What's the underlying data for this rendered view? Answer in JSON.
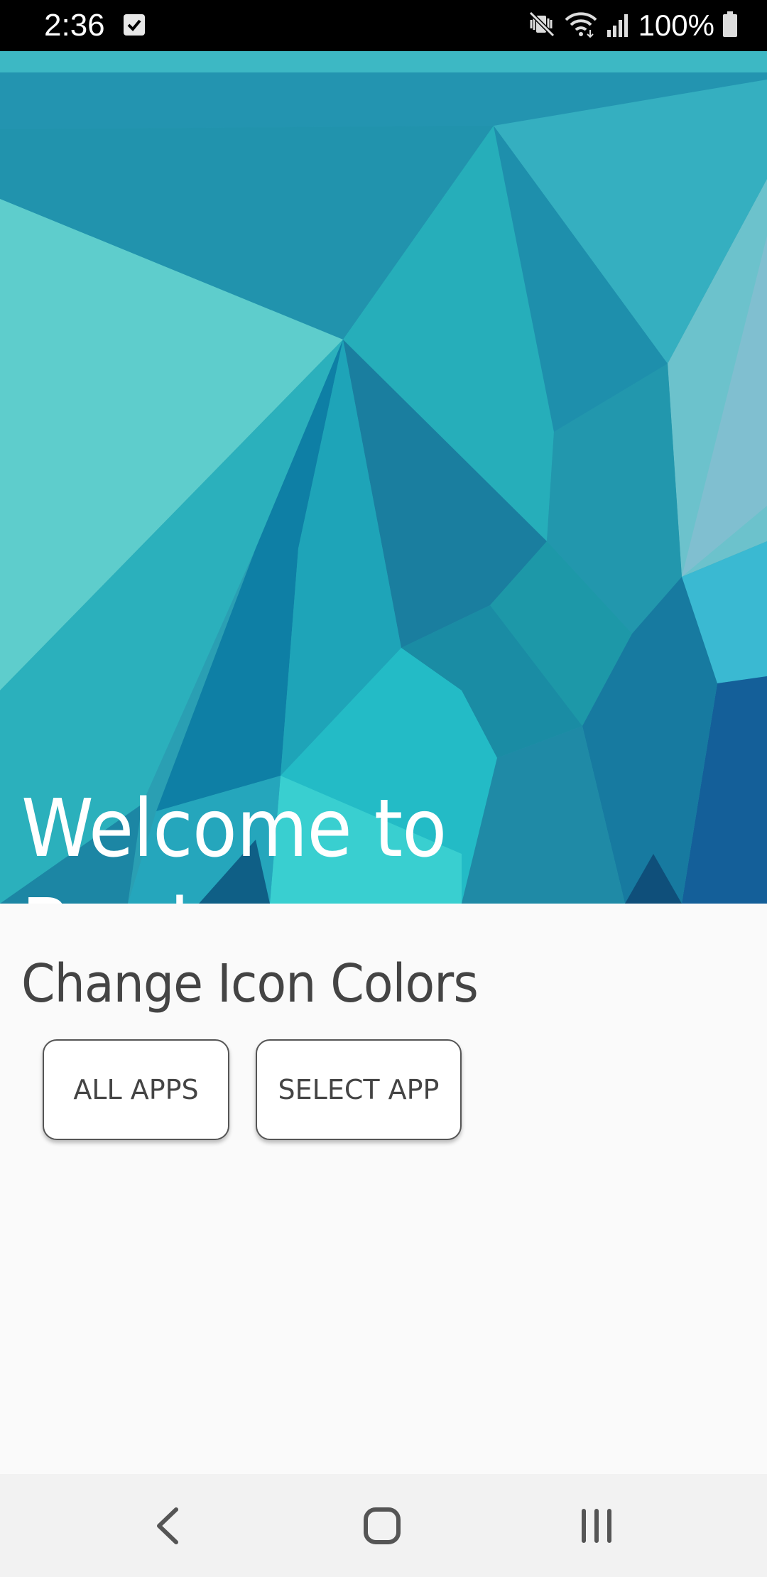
{
  "status_bar": {
    "time": "2:36",
    "battery": "100%",
    "icons": [
      "checkbox-notification-icon",
      "mute-vibrate-icon",
      "wifi-icon",
      "signal-icon",
      "battery-icon"
    ]
  },
  "hero": {
    "title": "Welcome to Border",
    "colors": [
      "#2a9fb3",
      "#5ecdcc",
      "#0e7fa5",
      "#23bbc6"
    ]
  },
  "main": {
    "section_title": "Change Icon Colors",
    "buttons": {
      "all_apps": "ALL APPS",
      "select_app": "SELECT APP"
    }
  },
  "nav": {
    "icons": [
      "back-icon",
      "home-icon",
      "recent-apps-icon"
    ]
  }
}
